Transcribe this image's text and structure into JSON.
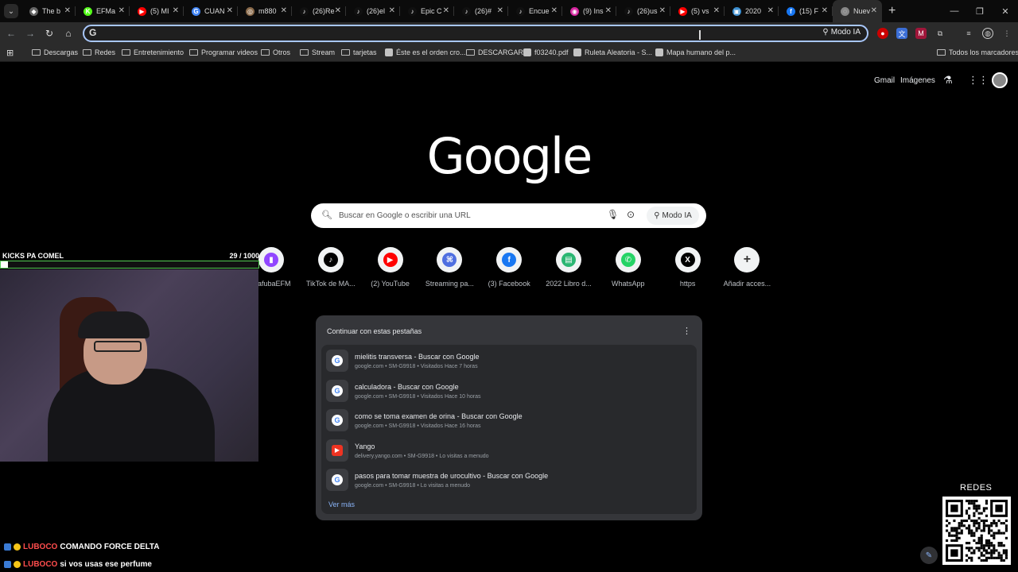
{
  "tabs": [
    {
      "label": "The b",
      "color": "#666666",
      "glyph": "◆"
    },
    {
      "label": "EFMa",
      "color": "#53fc18",
      "glyph": "K"
    },
    {
      "label": "(5) MI",
      "color": "#ff0000",
      "glyph": "▶"
    },
    {
      "label": "CUAN",
      "color": "#4285f4",
      "glyph": "G"
    },
    {
      "label": "m880",
      "color": "#8a6a4a",
      "glyph": "◎"
    },
    {
      "label": "(26)Re",
      "color": "#111111",
      "glyph": "♪"
    },
    {
      "label": "(26)el",
      "color": "#111111",
      "glyph": "♪"
    },
    {
      "label": "Epic C",
      "color": "#111111",
      "glyph": "♪"
    },
    {
      "label": "(26)#",
      "color": "#111111",
      "glyph": "♪"
    },
    {
      "label": "Encue",
      "color": "#111111",
      "glyph": "♪"
    },
    {
      "label": "(9) Ins",
      "color": "#d6249f",
      "glyph": "◉"
    },
    {
      "label": "(26)us",
      "color": "#111111",
      "glyph": "♪"
    },
    {
      "label": "(5) vs",
      "color": "#ff0000",
      "glyph": "▶"
    },
    {
      "label": "2020",
      "color": "#3b8ed0",
      "glyph": "▣"
    },
    {
      "label": "(15) F",
      "color": "#1877f2",
      "glyph": "f"
    },
    {
      "label": "Nuev",
      "color": "#888888",
      "glyph": "◌",
      "active": true
    }
  ],
  "toolbar": {
    "omnibox_value": "",
    "omnibox_ia_label": "Modo IA"
  },
  "bookmarks": [
    {
      "label": "Descargas",
      "kind": "folder"
    },
    {
      "label": "Redes",
      "kind": "folder"
    },
    {
      "label": "Entretenimiento",
      "kind": "folder"
    },
    {
      "label": "Programar videos",
      "kind": "folder"
    },
    {
      "label": "Otros",
      "kind": "folder"
    },
    {
      "label": "Stream",
      "kind": "folder"
    },
    {
      "label": "tarjetas",
      "kind": "folder"
    },
    {
      "label": "Éste es el orden cro...",
      "kind": "site"
    },
    {
      "label": "DESCARGAR",
      "kind": "folder"
    },
    {
      "label": "f03240.pdf",
      "kind": "site"
    },
    {
      "label": "Ruleta Aleatoria - S...",
      "kind": "site"
    },
    {
      "label": "Mapa humano del p...",
      "kind": "site"
    },
    {
      "label": "Todos los marcadores",
      "kind": "folder"
    }
  ],
  "google": {
    "logo": "Google",
    "gmail": "Gmail",
    "images": "Imágenes",
    "search_placeholder": "Buscar en Google o escribir una URL",
    "ia_button": "Modo IA"
  },
  "shortcuts": [
    {
      "label": "MafubaEFM",
      "color": "#9146ff",
      "glyph": "▮"
    },
    {
      "label": "TikTok de MA...",
      "color": "#000000",
      "glyph": "♪"
    },
    {
      "label": "(2) YouTube",
      "color": "#ff0000",
      "glyph": "▶"
    },
    {
      "label": "Streaming pa...",
      "color": "#4f6fe0",
      "glyph": "⌘"
    },
    {
      "label": "(3) Facebook",
      "color": "#1877f2",
      "glyph": "f"
    },
    {
      "label": "2022 Libro d...",
      "color": "#2bb673",
      "glyph": "▤"
    },
    {
      "label": "WhatsApp",
      "color": "#25d366",
      "glyph": "✆"
    },
    {
      "label": "https",
      "color": "#000000",
      "glyph": "X"
    },
    {
      "label": "Añadir acces...",
      "color": "#f1f3f4",
      "glyph": "+"
    }
  ],
  "continue_tabs": {
    "title": "Continuar con estas pestañas",
    "more": "Ver más",
    "items": [
      {
        "title": "mielitis transversa - Buscar con Google",
        "sub": "google.com • SM-G9918 • Visitados Hace 7 horas",
        "icon": "google"
      },
      {
        "title": "calculadora - Buscar con Google",
        "sub": "google.com • SM-G9918 • Visitados Hace 10 horas",
        "icon": "google"
      },
      {
        "title": "como se toma examen de orina - Buscar con Google",
        "sub": "google.com • SM-G9918 • Visitados Hace 16 horas",
        "icon": "google"
      },
      {
        "title": "Yango",
        "sub": "delivery.yango.com • SM-G9918 • Lo visitas a menudo",
        "icon": "yango"
      },
      {
        "title": "pasos para tomar muestra de urocultivo - Buscar con Google",
        "sub": "google.com • SM-G9918 • Lo visitas a menudo",
        "icon": "google"
      }
    ]
  },
  "stream": {
    "goal_title": "KICKS PA COMEL",
    "goal_count": "29  / 1000",
    "goal_progress": 0.029,
    "redes_label": "REDES",
    "chat": [
      {
        "user": "LUBOCO",
        "message": "COMANDO FORCE DELTA"
      },
      {
        "user": "LUBOCO",
        "message": "si vos usas ese perfume"
      }
    ]
  }
}
